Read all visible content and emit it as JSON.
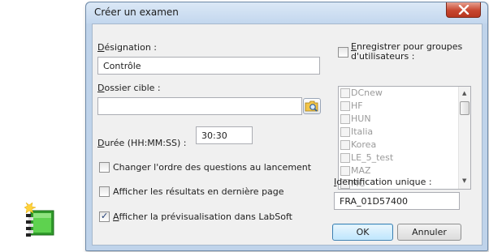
{
  "window": {
    "title": "Créer un examen"
  },
  "form": {
    "designation": {
      "label": "Désignation :",
      "label_mnemonic": "D",
      "label_rest": "ésignation :",
      "value": "Contrôle"
    },
    "target_folder": {
      "label": "Dossier cible :",
      "label_mnemonic": "D",
      "label_rest": "ossier cible :",
      "value": ""
    },
    "duration": {
      "label": "Durée (HH:MM:SS) :",
      "label_mnemonic": "D",
      "label_rest": "urée (HH:MM:SS) :",
      "value": "30:30"
    },
    "options": [
      {
        "label": "Changer l'ordre des questions au lancement",
        "checked": false
      },
      {
        "label": "Afficher les résultats en dernière page",
        "checked": false
      },
      {
        "label": "Afficher la prévisualisation dans LabSoft",
        "checked": true,
        "label_mnemonic": "A",
        "label_rest": "fficher la prévisualisation dans LabSoft"
      }
    ]
  },
  "groups": {
    "label_line1_mnemonic": "E",
    "label_line1_rest": "nregistrer pour groupes",
    "label_line2": "d'utilisateurs :",
    "label": "Enregistrer pour groupes d'utilisateurs :",
    "checked": false,
    "items": [
      "DCnew",
      "HF",
      "HUN",
      "Italia",
      "Korea",
      "LE_5_test",
      "MAZ",
      "MC"
    ]
  },
  "unique_id": {
    "label": "Identification unique :",
    "label_mnemonic": "I",
    "label_rest": "dentification unique :",
    "value": "FRA_01D57400"
  },
  "buttons": {
    "ok": "OK",
    "cancel": "Annuler"
  },
  "colors": {
    "titlebar": "#c3d7ee",
    "close_button": "#c7462f",
    "client_background": "#f0f0f0",
    "ok_border": "#3c7fb1",
    "disabled_text": "#9a9a9a"
  },
  "icons": {
    "app_icon": "green-package-icon",
    "close": "close-icon",
    "browse": "folder-search-icon"
  }
}
